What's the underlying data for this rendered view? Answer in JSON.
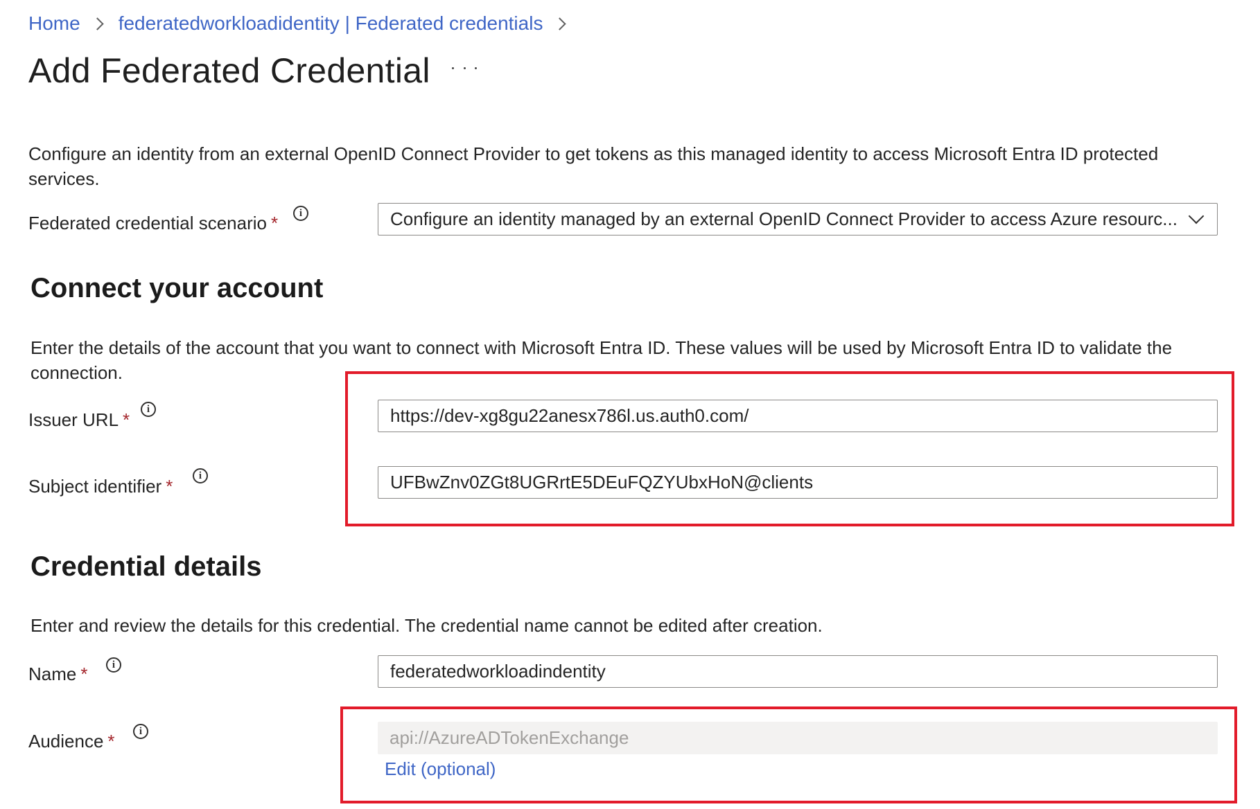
{
  "breadcrumb": {
    "items": [
      {
        "label": "Home"
      },
      {
        "label": "federatedworkloadidentity | Federated credentials"
      }
    ]
  },
  "page": {
    "title": "Add Federated Credential",
    "more_icon": "ellipsis-icon"
  },
  "intro": {
    "description": "Configure an identity from an external OpenID Connect Provider to get tokens as this managed identity to access Microsoft Entra ID protected services."
  },
  "scenario": {
    "label": "Federated credential scenario",
    "required_marker": "*",
    "value": "Configure an identity managed by an external OpenID Connect Provider to access Azure resourc..."
  },
  "connect_section": {
    "heading": "Connect your account",
    "description": "Enter the details of the account that you want to connect with Microsoft Entra ID. These values will be used by Microsoft Entra ID to validate the connection.",
    "issuer": {
      "label": "Issuer URL",
      "required_marker": "*",
      "value": "https://dev-xg8gu22anesx786l.us.auth0.com/"
    },
    "subject": {
      "label": "Subject identifier",
      "required_marker": "*",
      "value": "UFBwZnv0ZGt8UGRrtE5DEuFQZYUbxHoN@clients"
    }
  },
  "credential_section": {
    "heading": "Credential details",
    "description": "Enter and review the details for this credential. The credential name cannot be edited after creation.",
    "name": {
      "label": "Name",
      "required_marker": "*",
      "value": "federatedworkloadindentity"
    },
    "audience": {
      "label": "Audience",
      "required_marker": "*",
      "value": "api://AzureADTokenExchange",
      "edit_link": "Edit (optional)"
    }
  },
  "colors": {
    "link": "#3f66c6",
    "required": "#a4262c",
    "highlight": "#e21b2a",
    "disabled_bg": "#f3f2f1"
  }
}
